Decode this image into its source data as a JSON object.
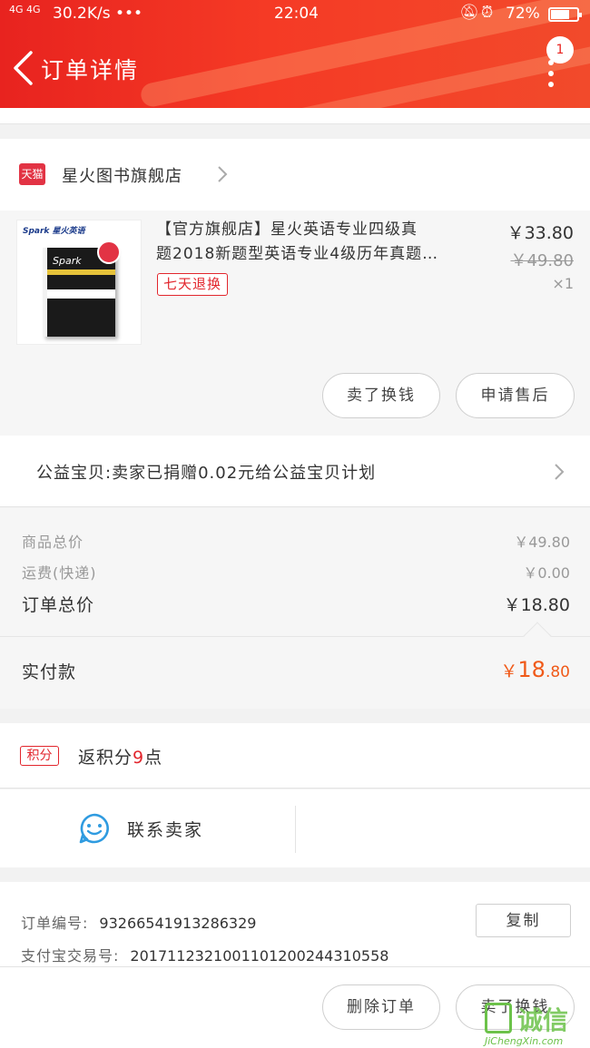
{
  "status_bar": {
    "network": "4G 4G",
    "speed": "30.2K/s •••",
    "time": "22:04",
    "battery": "72%",
    "battery_level": 0.72
  },
  "header": {
    "title": "订单详情",
    "badge_count": "1",
    "bg_color": "#ee2b22"
  },
  "shop": {
    "platform_tag": "天猫",
    "name": "星火图书旗舰店"
  },
  "item": {
    "title_line1": "【官方旗舰店】星火英语专业四级真",
    "title_line2": "题2018新题型英语专业4级历年真题…",
    "tag": "七天退换",
    "price": "￥33.80",
    "original_price": "￥49.80",
    "quantity": "×1",
    "thumbnail_brand": "Spark 星火英语"
  },
  "item_actions": {
    "sell_label": "卖了换钱",
    "after_sales_label": "申请售后"
  },
  "charity": {
    "text": "公益宝贝:卖家已捐赠0.02元给公益宝贝计划"
  },
  "costs": {
    "goods_label": "商品总价",
    "goods_value": "￥49.80",
    "shipping_label": "运费(快递)",
    "shipping_value": "￥0.00",
    "total_label": "订单总价",
    "total_value": "￥18.80",
    "paid_label": "实付款",
    "paid_currency": "￥",
    "paid_integer": "18",
    "paid_decimal": ".80",
    "paid_color": "#f05a19"
  },
  "points": {
    "tag": "积分",
    "text_prefix": "返积分",
    "count": "9",
    "text_suffix": "点"
  },
  "contact": {
    "label": "联系卖家"
  },
  "order_info": {
    "order_no_label": "订单编号:",
    "order_no": "93266541913286329",
    "copy_label": "复制",
    "alipay_label": "支付宝交易号:",
    "alipay_no": "2017112321001101200244310558"
  },
  "bottom_actions": {
    "delete_label": "删除订单",
    "sell_label": "卖了换钱"
  },
  "watermark": {
    "text": "诚信",
    "url": "JiChengXin.com"
  }
}
